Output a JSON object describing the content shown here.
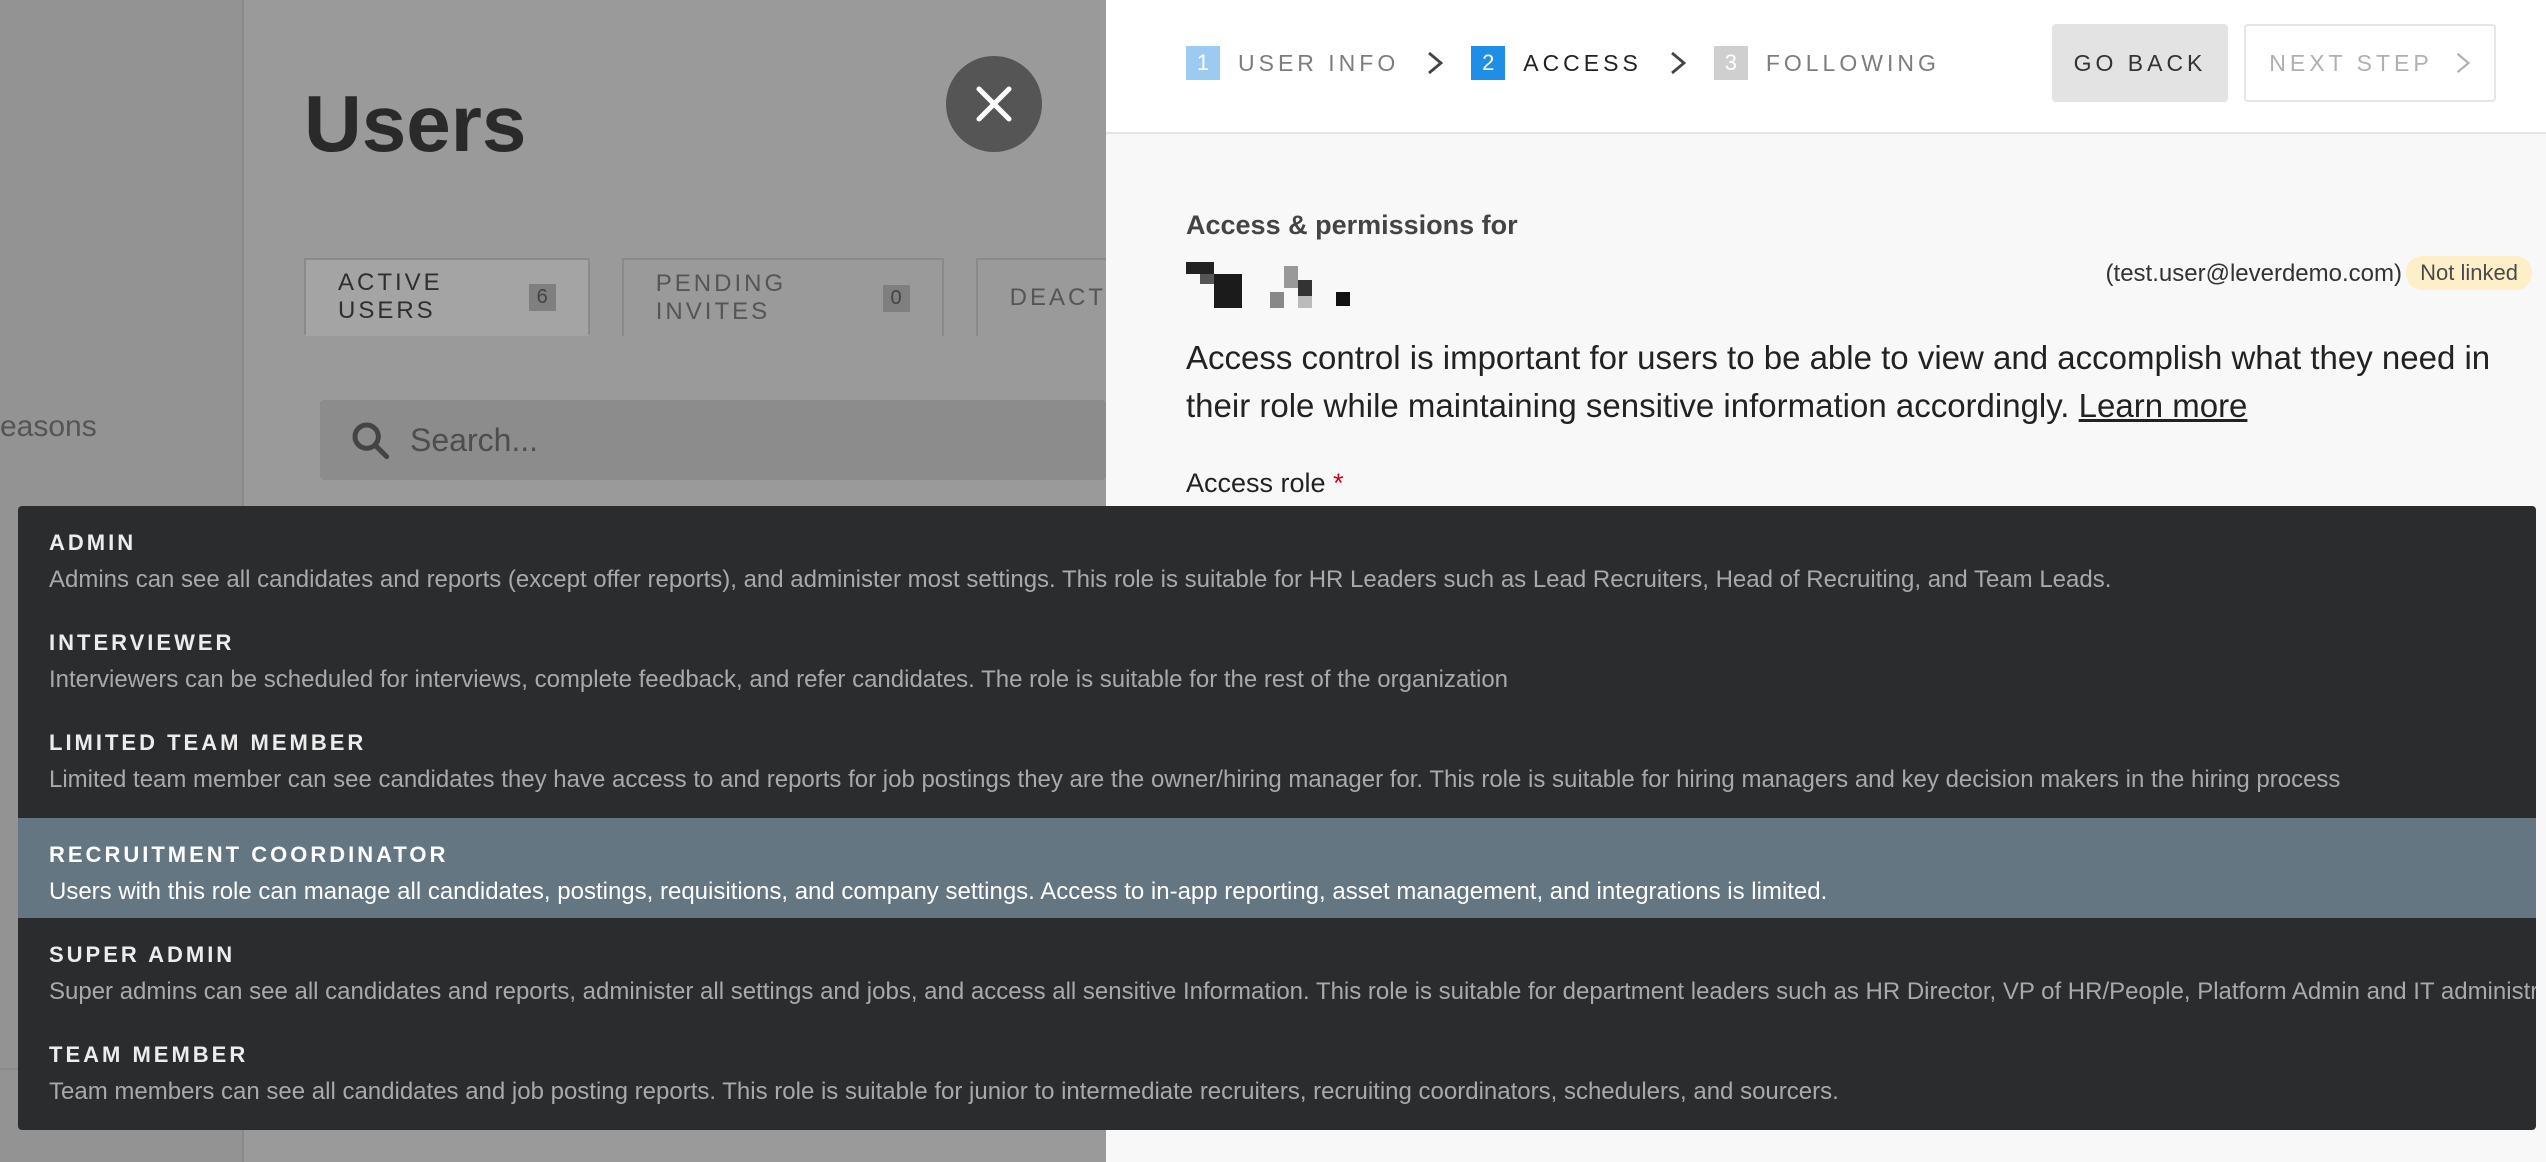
{
  "background": {
    "sidebar_text": "easons",
    "title": "Users",
    "tabs": [
      {
        "label": "ACTIVE USERS",
        "count": "6"
      },
      {
        "label": "PENDING INVITES",
        "count": "0"
      },
      {
        "label": "DEACT",
        "count": ""
      }
    ],
    "search_placeholder": "Search..."
  },
  "header": {
    "steps": [
      {
        "num": "1",
        "label": "USER INFO"
      },
      {
        "num": "2",
        "label": "ACCESS"
      },
      {
        "num": "3",
        "label": "FOLLOWING"
      }
    ],
    "go_back": "GO BACK",
    "next_step": "NEXT STEP"
  },
  "access": {
    "label": "Access & permissions for",
    "email": "(test.user@leverdemo.com)",
    "badge": "Not linked",
    "description": "Access control is important for users to be able to view and accomplish what they need in their role while maintaining sensitive information accordingly.",
    "learn_more": "Learn more",
    "role_label": "Access role",
    "required_mark": "*"
  },
  "roles": [
    {
      "name": "ADMIN",
      "desc": "Admins can see all candidates and reports (except offer reports), and administer most settings. This role is suitable for HR Leaders such as Lead Recruiters, Head of Recruiting, and Team Leads."
    },
    {
      "name": "INTERVIEWER",
      "desc": "Interviewers can be scheduled for interviews, complete feedback, and refer candidates. The role is suitable for the rest of the organization"
    },
    {
      "name": "LIMITED TEAM MEMBER",
      "desc": "Limited team member can see candidates they have access to and reports for job postings they are the owner/hiring manager for. This role is suitable for hiring managers and key decision makers in the hiring process"
    },
    {
      "name": "RECRUITMENT COORDINATOR",
      "desc": "Users with this role can manage all candidates, postings, requisitions, and company settings. Access to in-app reporting, asset management, and integrations is limited."
    },
    {
      "name": "SUPER ADMIN",
      "desc": "Super admins can see all candidates and reports, administer all settings and jobs, and access all sensitive Information. This role is suitable for department leaders such as HR Director, VP of HR/People, Platform Admin and IT administrators."
    },
    {
      "name": "TEAM MEMBER",
      "desc": "Team members can see all candidates and job posting reports. This role is suitable for junior to intermediate recruiters, recruiting coordinators, schedulers, and sourcers."
    }
  ],
  "colors": {
    "step_current": "#1e8ee6",
    "step_done": "#9dcaf1",
    "dropdown_bg": "#2b2c2e",
    "selected_bg": "#637681",
    "badge_bg": "#fdf0c8"
  }
}
